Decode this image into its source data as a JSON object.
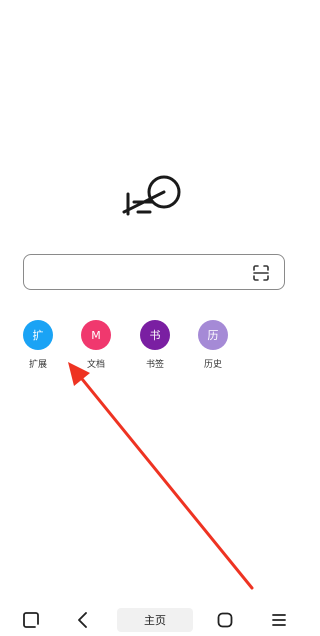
{
  "search": {
    "value": "",
    "placeholder": ""
  },
  "shortcuts": [
    {
      "label": "扩展",
      "glyph": "扩",
      "color": "#1aa3f5",
      "icon": "extension-icon"
    },
    {
      "label": "文档",
      "glyph": "M",
      "color": "#f0386e",
      "icon": "document-icon"
    },
    {
      "label": "书签",
      "glyph": "书",
      "color": "#7a1fa2",
      "icon": "bookmark-icon"
    },
    {
      "label": "历史",
      "glyph": "历",
      "color": "#a58ad6",
      "icon": "history-icon"
    }
  ],
  "bottom_nav": {
    "home_label": "主页"
  },
  "annotation": {
    "arrow_color": "#ee3322"
  }
}
